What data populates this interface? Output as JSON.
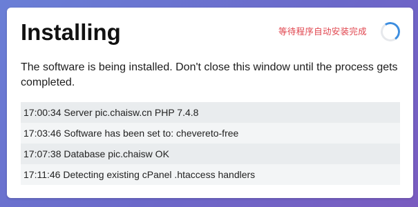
{
  "card": {
    "title": "Installing",
    "status_note": "等待程序自动安装完成",
    "description": "The software is being installed. Don't close this window until the process gets completed."
  },
  "log": [
    {
      "text": "17:00:34 Server pic.chaisw.cn PHP 7.4.8"
    },
    {
      "text": "17:03:46 Software has been set to: chevereto-free"
    },
    {
      "text": "17:07:38 Database pic.chaisw OK"
    },
    {
      "text": "17:11:46 Detecting existing cPanel .htaccess handlers"
    }
  ],
  "icons": {
    "spinner": "loading-spinner-icon"
  },
  "colors": {
    "status_note": "#e0444d",
    "spinner_accent": "#3d8ee0",
    "background_gradient_start": "#6a7fd6",
    "background_gradient_end": "#7a5cc0"
  }
}
